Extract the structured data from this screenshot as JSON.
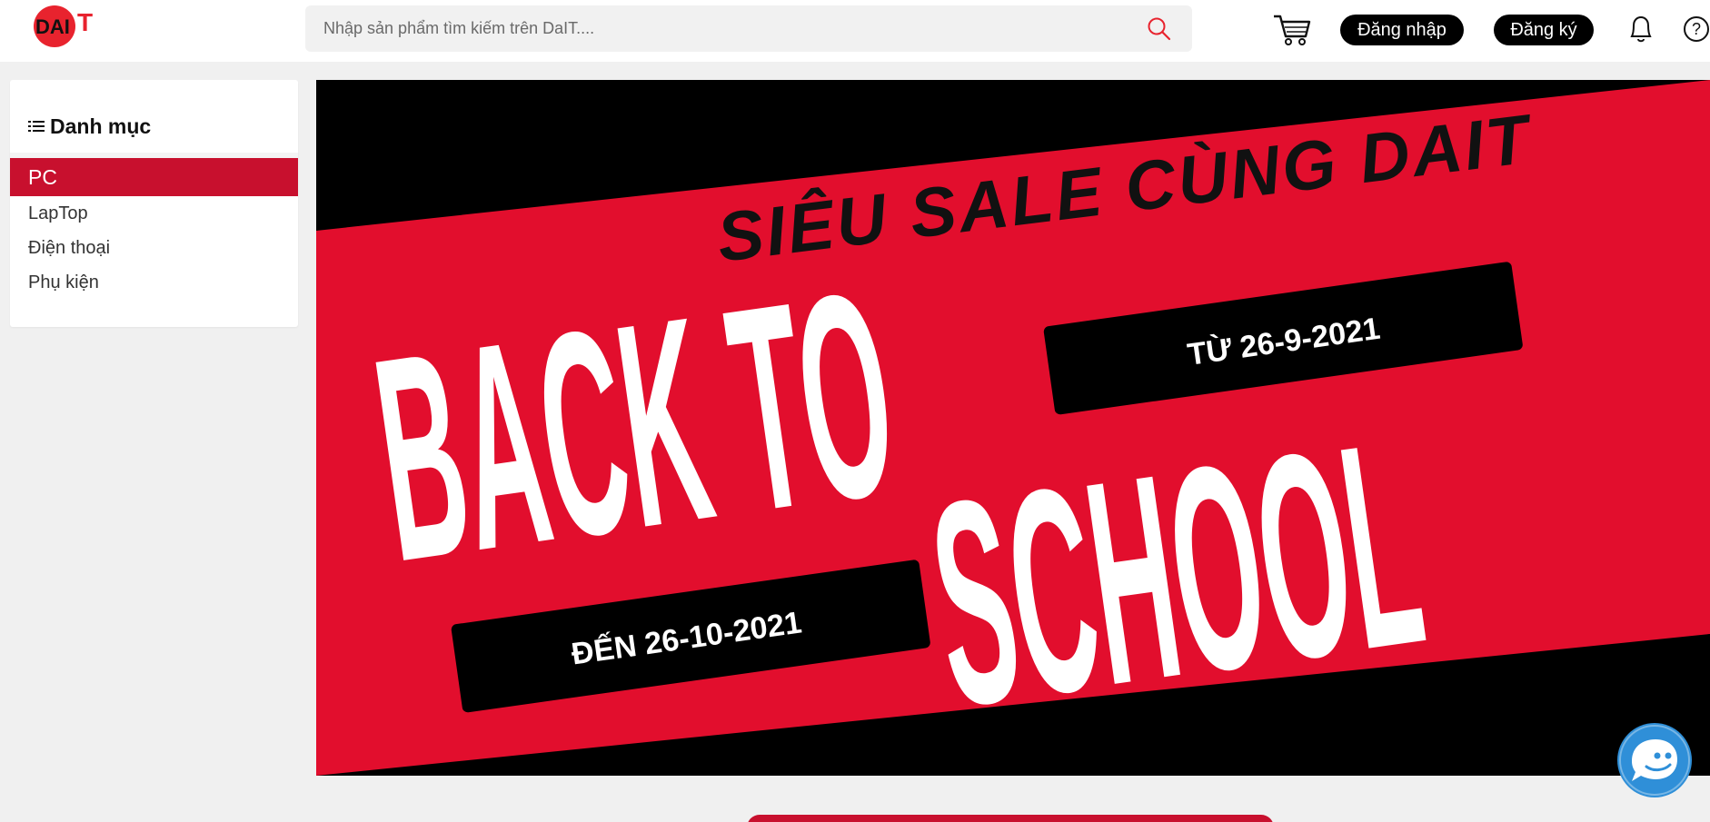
{
  "header": {
    "logo_text": "DAIT",
    "search": {
      "placeholder": "Nhập sản phẩm tìm kiếm trên DaIT...."
    },
    "login_label": "Đăng nhập",
    "register_label": "Đăng ký",
    "icons": [
      "search-icon",
      "cart-icon",
      "bell-icon",
      "help-icon"
    ]
  },
  "sidebar": {
    "title": "Danh mục",
    "items": [
      {
        "label": "PC",
        "active": true
      },
      {
        "label": "LapTop",
        "active": false
      },
      {
        "label": "Điện thoại",
        "active": false
      },
      {
        "label": "Phụ kiện",
        "active": false
      }
    ]
  },
  "banner": {
    "tagline": "SIÊU  SALE CÙNG DAIT",
    "headline_1": "BACK TO",
    "headline_2": "SCHOOL",
    "date_from": "TỪ 26-9-2021",
    "date_to": "ĐẾN 26-10-2021"
  },
  "colors": {
    "accent": "#c8102e",
    "banner_red": "#e20e2d",
    "black": "#000000",
    "chat_blue": "#2f8fd8"
  }
}
